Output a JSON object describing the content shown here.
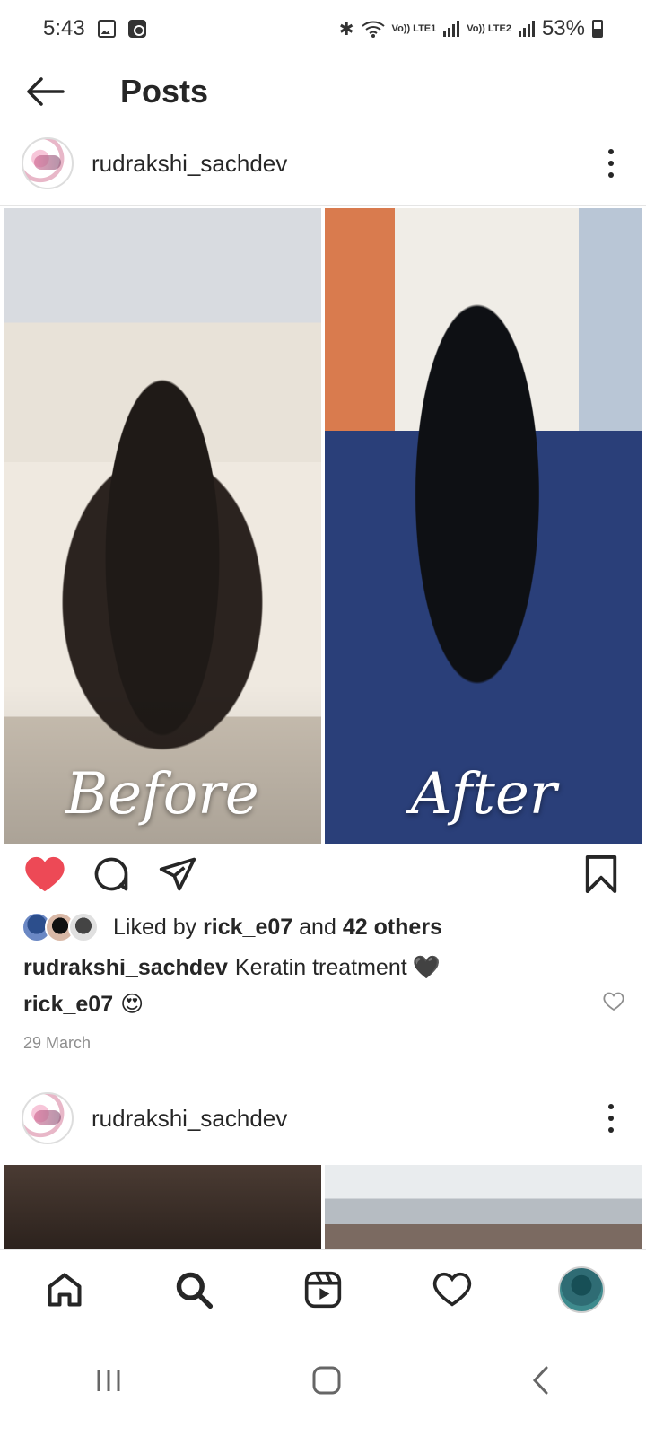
{
  "status": {
    "time": "5:43",
    "battery": "53%",
    "sim1": "Vo)) LTE1",
    "sim2": "Vo)) LTE2"
  },
  "header": {
    "title": "Posts",
    "back_icon": "arrow-left-icon"
  },
  "post": {
    "username": "rudrakshi_sachdev",
    "image_labels": [
      "Before",
      "After"
    ],
    "likes": {
      "prefix": "Liked by",
      "user": "rick_e07",
      "joiner": "and",
      "others": "42 others"
    },
    "caption": {
      "username": "rudrakshi_sachdev",
      "text": "Keratin treatment",
      "emoji": "🖤"
    },
    "comment": {
      "username": "rick_e07",
      "emoji": "😍"
    },
    "date": "29 March"
  },
  "next_post": {
    "username": "rudrakshi_sachdev"
  },
  "bottom_nav": [
    "home-icon",
    "search-icon",
    "reels-icon",
    "heart-icon",
    "profile-avatar"
  ],
  "colors": {
    "like_red": "#ed4956",
    "text": "#262626",
    "muted": "#8e8e8e"
  }
}
